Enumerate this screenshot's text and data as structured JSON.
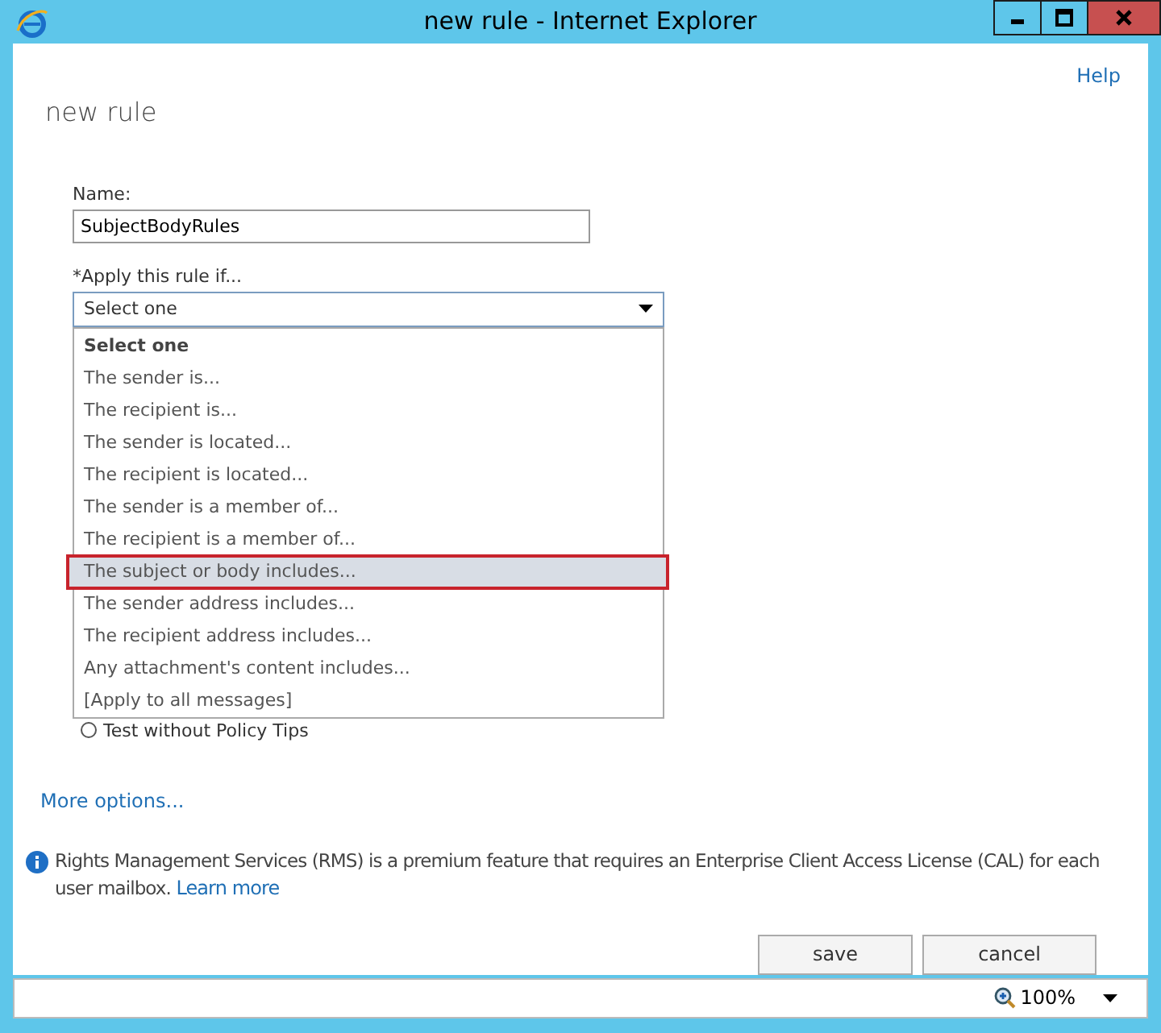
{
  "window": {
    "title": "new rule - Internet Explorer"
  },
  "help_link": "Help",
  "page_title": "new rule",
  "name_field": {
    "label": "Name:",
    "value": "SubjectBodyRules"
  },
  "apply_field": {
    "label": "*Apply this rule if...",
    "value": "Select one",
    "expanded": true,
    "options": [
      {
        "label": "Select one",
        "selected": true,
        "highlighted": false
      },
      {
        "label": "The sender is...",
        "selected": false,
        "highlighted": false
      },
      {
        "label": "The recipient is...",
        "selected": false,
        "highlighted": false
      },
      {
        "label": "The sender is located...",
        "selected": false,
        "highlighted": false
      },
      {
        "label": "The recipient is located...",
        "selected": false,
        "highlighted": false
      },
      {
        "label": "The sender is a member of...",
        "selected": false,
        "highlighted": false
      },
      {
        "label": "The recipient is a member of...",
        "selected": false,
        "highlighted": false
      },
      {
        "label": "The subject or body includes...",
        "selected": false,
        "highlighted": true
      },
      {
        "label": "The sender address includes...",
        "selected": false,
        "highlighted": false
      },
      {
        "label": "The recipient address includes...",
        "selected": false,
        "highlighted": false
      },
      {
        "label": "Any attachment's content includes...",
        "selected": false,
        "highlighted": false
      },
      {
        "label": "[Apply to all messages]",
        "selected": false,
        "highlighted": false
      }
    ]
  },
  "mode_radio": {
    "label": "Test without Policy Tips",
    "selected": false
  },
  "more_options": "More options...",
  "info": {
    "text": "Rights Management Services (RMS) is a premium feature that requires an Enterprise Client Access License (CAL) for each user mailbox.",
    "link": "Learn more"
  },
  "buttons": [
    "save",
    "cancel"
  ],
  "status_bar": {
    "zoom": "100%"
  }
}
